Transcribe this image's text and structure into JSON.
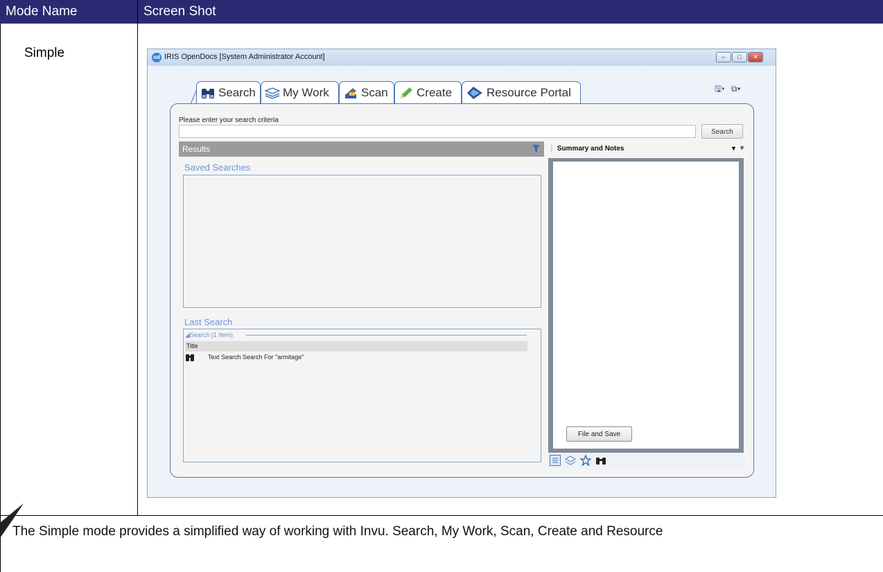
{
  "table": {
    "col1_header": "Mode Name",
    "col2_header": "Screen Shot",
    "mode_name": "Simple",
    "caption": "The Simple mode provides a simplified way of working with Invu.  Search, My Work, Scan, Create and Resource"
  },
  "window": {
    "title": "IRIS OpenDocs [System Administrator Account]",
    "logo_text": "od"
  },
  "tabs": [
    {
      "label": "Search",
      "icon": "binoculars-icon"
    },
    {
      "label": "My Work",
      "icon": "stack-icon"
    },
    {
      "label": "Scan",
      "icon": "scanner-icon"
    },
    {
      "label": "Create",
      "icon": "pencil-icon"
    },
    {
      "label": "Resource Portal",
      "icon": "film-icon"
    }
  ],
  "search": {
    "prompt": "Please enter your search criteria",
    "value": "",
    "button_label": "Search"
  },
  "results": {
    "title": "Results",
    "saved_searches_title": "Saved Searches",
    "last_search_title": "Last Search",
    "group_label": "Search (1 Item)",
    "column_header": "Title",
    "rows": [
      {
        "icon": "binoculars-icon",
        "title": "Text Search Search For \"armitage\""
      }
    ]
  },
  "summary": {
    "title": "Summary and Notes",
    "file_save_label": "File and Save"
  },
  "colors": {
    "header_bg": "#2a2a72",
    "accent_blue": "#4a78b8",
    "results_bar": "#9b9b9b"
  }
}
